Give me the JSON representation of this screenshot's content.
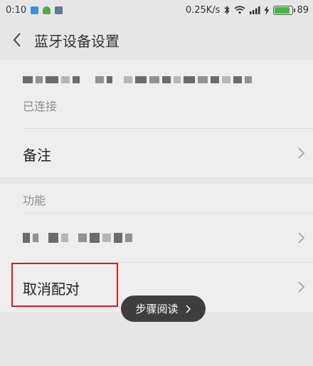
{
  "status_bar": {
    "time": "0:10",
    "network_speed": "0.25K/s",
    "battery_level": "89",
    "battery_percent": 0.89
  },
  "header": {
    "title": "蓝牙设备设置",
    "back_icon": "chevron-left-icon"
  },
  "device": {
    "status": "已连接"
  },
  "rows": {
    "note_label": "备注",
    "section_label": "功能",
    "unpair_label": "取消配对"
  },
  "toast": {
    "label": "步骤阅读"
  },
  "colors": {
    "background": "#e6e6e6",
    "card": "#eeeeee",
    "highlight": "#d32020",
    "battery": "#3ebb3e"
  }
}
